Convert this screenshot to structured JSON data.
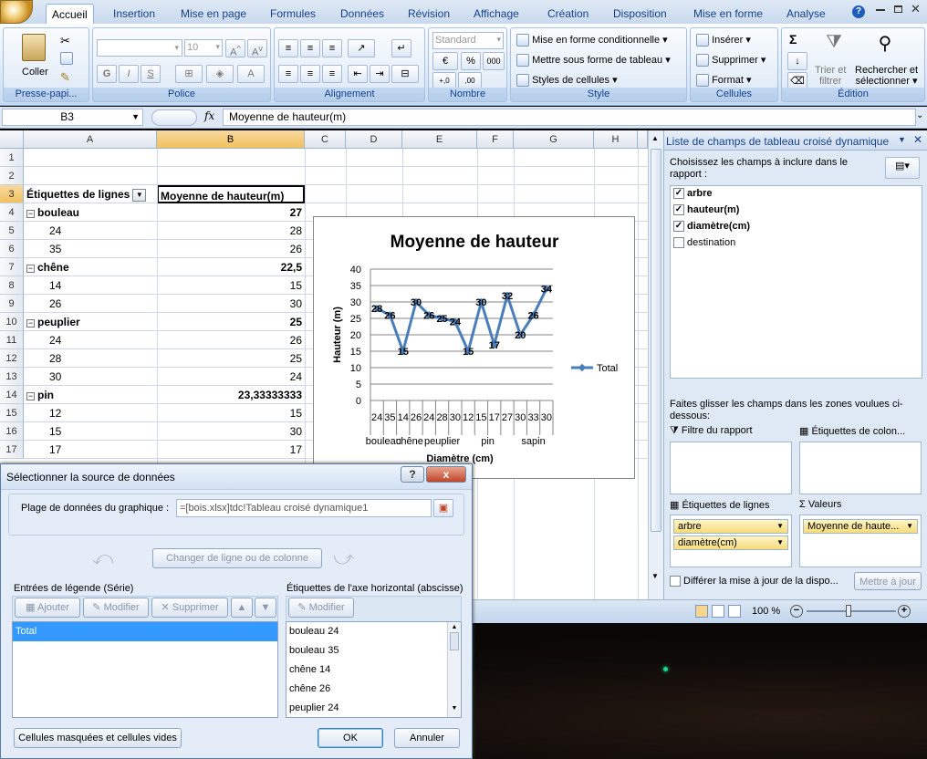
{
  "tabs": [
    "Accueil",
    "Insertion",
    "Mise en page",
    "Formules",
    "Données",
    "Révision",
    "Affichage",
    "Création",
    "Disposition",
    "Mise en forme",
    "Analyse"
  ],
  "ribbon": {
    "paste_label": "Coller",
    "clipboard_group": "Presse-papi...",
    "font_group": "Police",
    "font_size": "10",
    "bold": "G",
    "italic": "I",
    "underline": "S",
    "align_group": "Alignement",
    "number_group": "Nombre",
    "number_format": "Standard",
    "percent": "%",
    "thousands": "000",
    "style_group": "Style",
    "cond_format": "Mise en forme conditionnelle",
    "format_table": "Mettre sous forme de tableau",
    "cell_styles": "Styles de cellules",
    "cells_group": "Cellules",
    "insert": "Insérer",
    "delete": "Supprimer",
    "format": "Format",
    "edit_group": "Édition",
    "sigma": "Σ",
    "sort_line1": "Trier et",
    "sort_line2": "filtrer",
    "find_line1": "Rechercher et",
    "find_line2": "sélectionner"
  },
  "formula_bar": {
    "cell_ref": "B3",
    "fx": "fx",
    "content": "Moyenne de hauteur(m)"
  },
  "grid": {
    "columns": [
      "A",
      "B",
      "C",
      "D",
      "E",
      "F",
      "G",
      "H"
    ],
    "rows": [
      {
        "num": "1",
        "a": "",
        "b": "",
        "type": "empty"
      },
      {
        "num": "2",
        "a": "",
        "b": "",
        "type": "empty"
      },
      {
        "num": "3",
        "a": "Étiquettes de lignes",
        "b": "Moyenne de hauteur(m)",
        "type": "header"
      },
      {
        "num": "4",
        "a": "bouleau",
        "b": "27",
        "type": "group"
      },
      {
        "num": "5",
        "a": "24",
        "b": "28",
        "type": "item"
      },
      {
        "num": "6",
        "a": "35",
        "b": "26",
        "type": "item"
      },
      {
        "num": "7",
        "a": "chêne",
        "b": "22,5",
        "type": "group"
      },
      {
        "num": "8",
        "a": "14",
        "b": "15",
        "type": "item"
      },
      {
        "num": "9",
        "a": "26",
        "b": "30",
        "type": "item"
      },
      {
        "num": "10",
        "a": "peuplier",
        "b": "25",
        "type": "group"
      },
      {
        "num": "11",
        "a": "24",
        "b": "26",
        "type": "item"
      },
      {
        "num": "12",
        "a": "28",
        "b": "25",
        "type": "item"
      },
      {
        "num": "13",
        "a": "30",
        "b": "24",
        "type": "item"
      },
      {
        "num": "14",
        "a": "pin",
        "b": "23,33333333",
        "type": "group"
      },
      {
        "num": "15",
        "a": "12",
        "b": "15",
        "type": "item"
      },
      {
        "num": "16",
        "a": "15",
        "b": "30",
        "type": "item"
      },
      {
        "num": "17",
        "a": "17",
        "b": "17",
        "type": "item"
      }
    ]
  },
  "chart_data": {
    "type": "line",
    "title": "Moyenne de hauteur",
    "xlabel": "Diamètre (cm)",
    "ylabel": "Hauteur (m)",
    "categories": [
      "24",
      "35",
      "14",
      "26",
      "24",
      "28",
      "30",
      "12",
      "15",
      "17",
      "27",
      "30",
      "33",
      "30"
    ],
    "groups": [
      {
        "name": "bouleau",
        "span": 2
      },
      {
        "name": "chêne",
        "span": 2
      },
      {
        "name": "peuplier",
        "span": 3
      },
      {
        "name": "pin",
        "span": 4
      },
      {
        "name": "sapin",
        "span": 3
      }
    ],
    "series": [
      {
        "name": "Total",
        "values": [
          28,
          26,
          15,
          30,
          26,
          25,
          24,
          15,
          30,
          17,
          32,
          20,
          26,
          34
        ]
      }
    ],
    "ylim": [
      0,
      40
    ],
    "yticks": [
      "0",
      "5",
      "10",
      "15",
      "20",
      "25",
      "30",
      "35",
      "40"
    ],
    "legend": "right",
    "grid": true,
    "line_color": "#4a7ebb"
  },
  "pane": {
    "title": "Liste de champs de tableau croisé dynamique",
    "instruction": "Choisissez les champs à inclure dans le rapport :",
    "fields": [
      {
        "label": "arbre",
        "checked": true
      },
      {
        "label": "hauteur(m)",
        "checked": true
      },
      {
        "label": "diamètre(cm)",
        "checked": true
      },
      {
        "label": "destination",
        "checked": false
      }
    ],
    "drag_text": "Faites glisser les champs dans les zones voulues ci-dessous:",
    "zone_filter": "Filtre du rapport",
    "zone_columns": "Étiquettes de colon...",
    "zone_rows": "Étiquettes de lignes",
    "zone_values": "Valeurs",
    "row_fields": [
      "arbre",
      "diamètre(cm)"
    ],
    "value_field": "Moyenne de haute...",
    "defer_label": "Différer la mise à jour de la dispo...",
    "update_button": "Mettre à jour"
  },
  "status": {
    "zoom": "100 %"
  },
  "dialog": {
    "title": "Sélectionner la source de données",
    "range_label": "Plage de données du graphique :",
    "range_value": "=[bois.xlsx]tdc!Tableau croisé dynamique1",
    "switch_button": "Changer de ligne ou de colonne",
    "legend_label": "Entrées de légende (Série)",
    "axis_label": "Étiquettes de l'axe horizontal (abscisse)",
    "add_button": "Ajouter",
    "modify_button": "Modifier",
    "delete_button": "Supprimer",
    "axis_modify_button": "Modifier",
    "series": [
      "Total"
    ],
    "axis_items": [
      "bouleau 24",
      "bouleau 35",
      "chêne 14",
      "chêne 26",
      "peuplier 24"
    ],
    "hidden_cells_button": "Cellules masquées et cellules vides",
    "ok_button": "OK",
    "cancel_button": "Annuler",
    "help": "?",
    "close": "x"
  }
}
